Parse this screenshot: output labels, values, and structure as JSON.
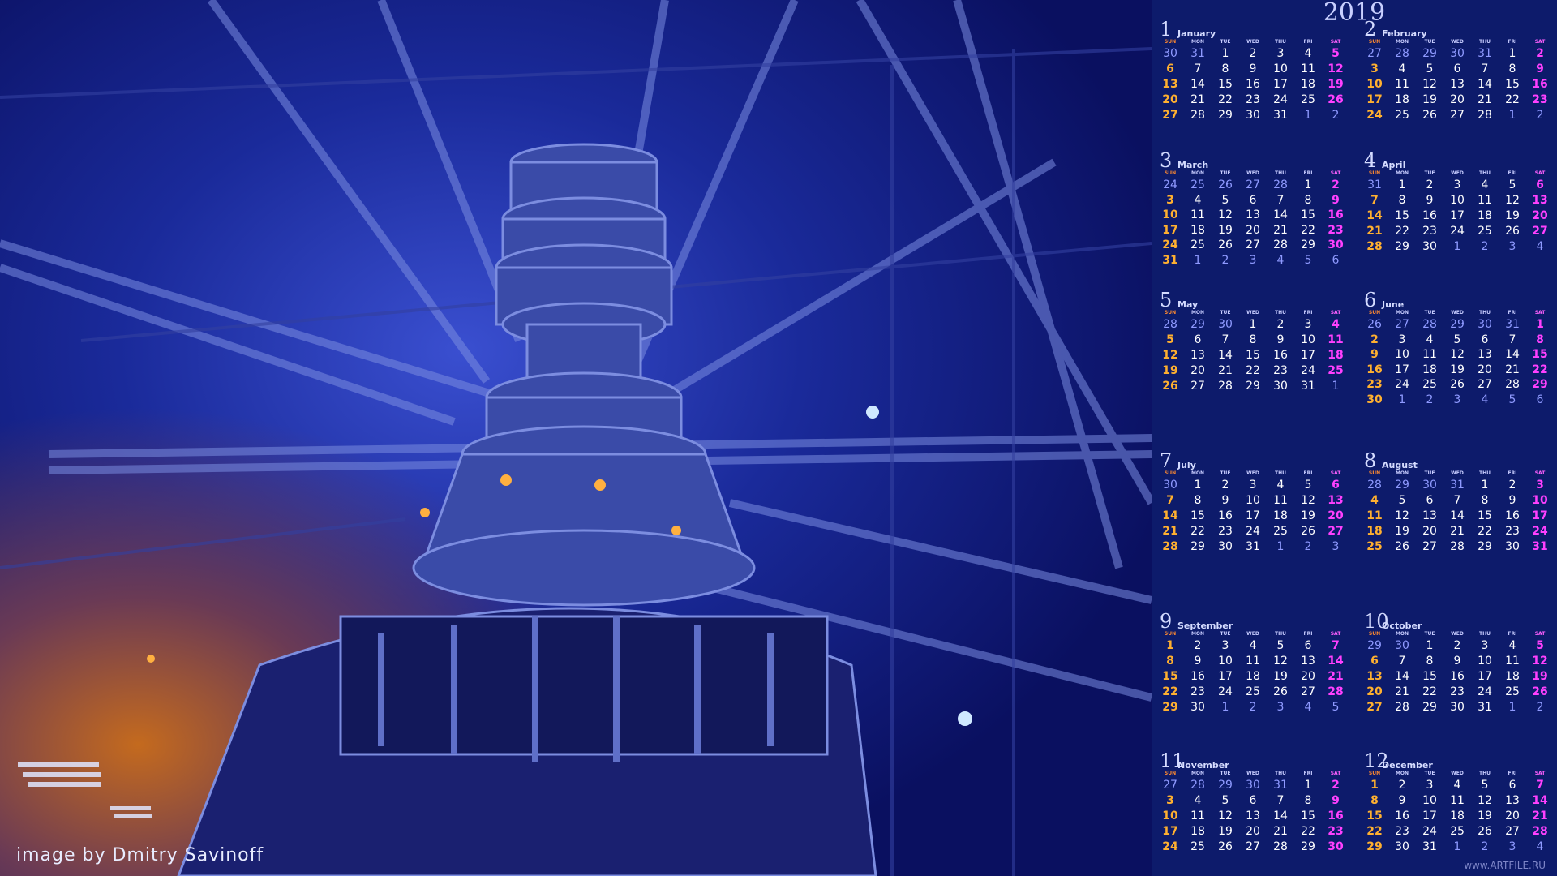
{
  "year": "2019",
  "credit": "image by Dmitry Savinoff",
  "watermark": "www.ARTFILE.RU",
  "weekdays": [
    "SUN",
    "MON",
    "TUE",
    "WED",
    "THU",
    "FRI",
    "SAT"
  ],
  "months": [
    {
      "num": "1",
      "name": "January",
      "weeks": [
        [
          "30",
          "31",
          "1",
          "2",
          "3",
          "4",
          "5"
        ],
        [
          "6",
          "7",
          "8",
          "9",
          "10",
          "11",
          "12"
        ],
        [
          "13",
          "14",
          "15",
          "16",
          "17",
          "18",
          "19"
        ],
        [
          "20",
          "21",
          "22",
          "23",
          "24",
          "25",
          "26"
        ],
        [
          "27",
          "28",
          "29",
          "30",
          "31",
          "1",
          "2"
        ]
      ]
    },
    {
      "num": "2",
      "name": "February",
      "weeks": [
        [
          "27",
          "28",
          "29",
          "30",
          "31",
          "1",
          "2"
        ],
        [
          "3",
          "4",
          "5",
          "6",
          "7",
          "8",
          "9"
        ],
        [
          "10",
          "11",
          "12",
          "13",
          "14",
          "15",
          "16"
        ],
        [
          "17",
          "18",
          "19",
          "20",
          "21",
          "22",
          "23"
        ],
        [
          "24",
          "25",
          "26",
          "27",
          "28",
          "1",
          "2"
        ]
      ]
    },
    {
      "num": "3",
      "name": "March",
      "weeks": [
        [
          "24",
          "25",
          "26",
          "27",
          "28",
          "1",
          "2"
        ],
        [
          "3",
          "4",
          "5",
          "6",
          "7",
          "8",
          "9"
        ],
        [
          "10",
          "11",
          "12",
          "13",
          "14",
          "15",
          "16"
        ],
        [
          "17",
          "18",
          "19",
          "20",
          "21",
          "22",
          "23"
        ],
        [
          "24",
          "25",
          "26",
          "27",
          "28",
          "29",
          "30"
        ],
        [
          "31",
          "1",
          "2",
          "3",
          "4",
          "5",
          "6"
        ]
      ]
    },
    {
      "num": "4",
      "name": "April",
      "weeks": [
        [
          "31",
          "1",
          "2",
          "3",
          "4",
          "5",
          "6"
        ],
        [
          "7",
          "8",
          "9",
          "10",
          "11",
          "12",
          "13"
        ],
        [
          "14",
          "15",
          "16",
          "17",
          "18",
          "19",
          "20"
        ],
        [
          "21",
          "22",
          "23",
          "24",
          "25",
          "26",
          "27"
        ],
        [
          "28",
          "29",
          "30",
          "1",
          "2",
          "3",
          "4"
        ]
      ]
    },
    {
      "num": "5",
      "name": "May",
      "weeks": [
        [
          "28",
          "29",
          "30",
          "1",
          "2",
          "3",
          "4"
        ],
        [
          "5",
          "6",
          "7",
          "8",
          "9",
          "10",
          "11"
        ],
        [
          "12",
          "13",
          "14",
          "15",
          "16",
          "17",
          "18"
        ],
        [
          "19",
          "20",
          "21",
          "22",
          "23",
          "24",
          "25"
        ],
        [
          "26",
          "27",
          "28",
          "29",
          "30",
          "31",
          "1"
        ]
      ]
    },
    {
      "num": "6",
      "name": "June",
      "weeks": [
        [
          "26",
          "27",
          "28",
          "29",
          "30",
          "31",
          "1"
        ],
        [
          "2",
          "3",
          "4",
          "5",
          "6",
          "7",
          "8"
        ],
        [
          "9",
          "10",
          "11",
          "12",
          "13",
          "14",
          "15"
        ],
        [
          "16",
          "17",
          "18",
          "19",
          "20",
          "21",
          "22"
        ],
        [
          "23",
          "24",
          "25",
          "26",
          "27",
          "28",
          "29"
        ],
        [
          "30",
          "1",
          "2",
          "3",
          "4",
          "5",
          "6"
        ]
      ]
    },
    {
      "num": "7",
      "name": "July",
      "weeks": [
        [
          "30",
          "1",
          "2",
          "3",
          "4",
          "5",
          "6"
        ],
        [
          "7",
          "8",
          "9",
          "10",
          "11",
          "12",
          "13"
        ],
        [
          "14",
          "15",
          "16",
          "17",
          "18",
          "19",
          "20"
        ],
        [
          "21",
          "22",
          "23",
          "24",
          "25",
          "26",
          "27"
        ],
        [
          "28",
          "29",
          "30",
          "31",
          "1",
          "2",
          "3"
        ]
      ]
    },
    {
      "num": "8",
      "name": "August",
      "weeks": [
        [
          "28",
          "29",
          "30",
          "31",
          "1",
          "2",
          "3"
        ],
        [
          "4",
          "5",
          "6",
          "7",
          "8",
          "9",
          "10"
        ],
        [
          "11",
          "12",
          "13",
          "14",
          "15",
          "16",
          "17"
        ],
        [
          "18",
          "19",
          "20",
          "21",
          "22",
          "23",
          "24"
        ],
        [
          "25",
          "26",
          "27",
          "28",
          "29",
          "30",
          "31"
        ]
      ]
    },
    {
      "num": "9",
      "name": "September",
      "weeks": [
        [
          "1",
          "2",
          "3",
          "4",
          "5",
          "6",
          "7"
        ],
        [
          "8",
          "9",
          "10",
          "11",
          "12",
          "13",
          "14"
        ],
        [
          "15",
          "16",
          "17",
          "18",
          "19",
          "20",
          "21"
        ],
        [
          "22",
          "23",
          "24",
          "25",
          "26",
          "27",
          "28"
        ],
        [
          "29",
          "30",
          "1",
          "2",
          "3",
          "4",
          "5"
        ]
      ]
    },
    {
      "num": "10",
      "name": "October",
      "weeks": [
        [
          "29",
          "30",
          "1",
          "2",
          "3",
          "4",
          "5"
        ],
        [
          "6",
          "7",
          "8",
          "9",
          "10",
          "11",
          "12"
        ],
        [
          "13",
          "14",
          "15",
          "16",
          "17",
          "18",
          "19"
        ],
        [
          "20",
          "21",
          "22",
          "23",
          "24",
          "25",
          "26"
        ],
        [
          "27",
          "28",
          "29",
          "30",
          "31",
          "1",
          "2"
        ]
      ]
    },
    {
      "num": "11",
      "name": "November",
      "weeks": [
        [
          "27",
          "28",
          "29",
          "30",
          "31",
          "1",
          "2"
        ],
        [
          "3",
          "4",
          "5",
          "6",
          "7",
          "8",
          "9"
        ],
        [
          "10",
          "11",
          "12",
          "13",
          "14",
          "15",
          "16"
        ],
        [
          "17",
          "18",
          "19",
          "20",
          "21",
          "22",
          "23"
        ],
        [
          "24",
          "25",
          "26",
          "27",
          "28",
          "29",
          "30"
        ]
      ]
    },
    {
      "num": "12",
      "name": "December",
      "weeks": [
        [
          "1",
          "2",
          "3",
          "4",
          "5",
          "6",
          "7"
        ],
        [
          "8",
          "9",
          "10",
          "11",
          "12",
          "13",
          "14"
        ],
        [
          "15",
          "16",
          "17",
          "18",
          "19",
          "20",
          "21"
        ],
        [
          "22",
          "23",
          "24",
          "25",
          "26",
          "27",
          "28"
        ],
        [
          "29",
          "30",
          "31",
          "1",
          "2",
          "3",
          "4"
        ]
      ]
    }
  ]
}
